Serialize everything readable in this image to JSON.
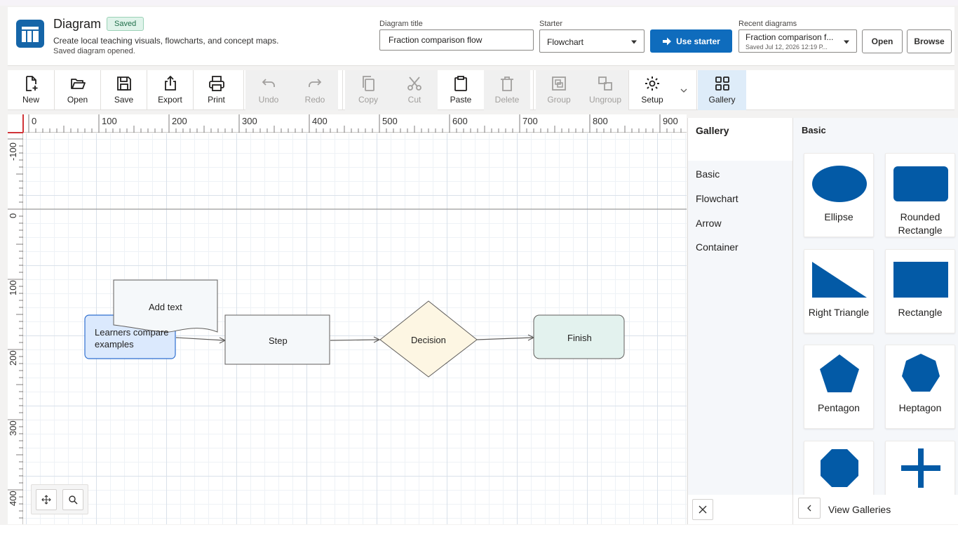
{
  "header": {
    "app_name": "Diagram",
    "saved_badge": "Saved",
    "description": "Create local teaching visuals, flowcharts, and concept maps.",
    "status": "Saved diagram opened.",
    "title_label": "Diagram title",
    "title_value": "Fraction comparison flow",
    "starter_label": "Starter",
    "starter_value": "Flowchart",
    "use_starter": "Use starter",
    "recent_label": "Recent diagrams",
    "recent_title": "Fraction comparison f...",
    "recent_sub": "Saved Jul 12, 2026 12:19 P...",
    "open": "Open",
    "browse": "Browse"
  },
  "toolbar": {
    "new": "New",
    "open": "Open",
    "save": "Save",
    "export": "Export",
    "print": "Print",
    "undo": "Undo",
    "redo": "Redo",
    "copy": "Copy",
    "cut": "Cut",
    "paste": "Paste",
    "delete": "Delete",
    "group": "Group",
    "ungroup": "Ungroup",
    "setup": "Setup",
    "gallery": "Gallery"
  },
  "rulers": {
    "top": [
      "0",
      "100",
      "200",
      "300",
      "400",
      "500",
      "600",
      "700",
      "800",
      "900"
    ],
    "left": [
      "-100",
      "0",
      "100",
      "200",
      "300",
      "400"
    ]
  },
  "canvas": {
    "note_text": "Add text",
    "start_text": "Learners compare examples",
    "step_text": "Step",
    "decision_text": "Decision",
    "finish_text": "Finish"
  },
  "gallery": {
    "title": "Gallery",
    "categories": [
      "Basic",
      "Flowchart",
      "Arrow",
      "Container"
    ],
    "section": "Basic",
    "shapes": [
      "Ellipse",
      "Rounded Rectangle",
      "Right Triangle",
      "Rectangle",
      "Pentagon",
      "Heptagon"
    ],
    "view_galleries": "View Galleries"
  },
  "colors": {
    "accent": "#0f6cbd",
    "shape_fill": "#035aa6",
    "start_fill": "#dbe9fd",
    "start_stroke": "#2f6fd0",
    "decision_fill": "#fdf6e3",
    "finish_fill": "#e3f2ee"
  }
}
